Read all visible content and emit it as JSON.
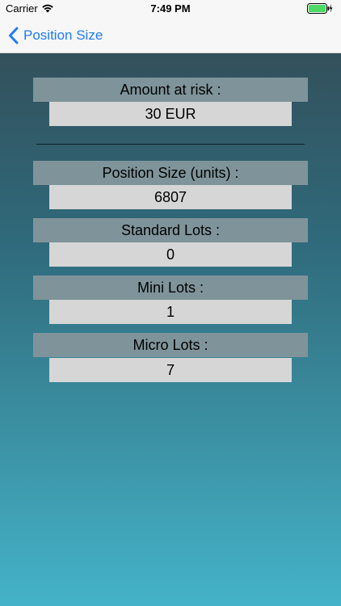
{
  "status_bar": {
    "carrier": "Carrier",
    "time": "7:49 PM"
  },
  "nav": {
    "back_label": "Position Size"
  },
  "results": {
    "amount_at_risk_label": "Amount at risk :",
    "amount_at_risk_value": "30 EUR",
    "position_size_label": "Position Size (units) :",
    "position_size_value": "6807",
    "standard_lots_label": "Standard Lots :",
    "standard_lots_value": "0",
    "mini_lots_label": "Mini Lots :",
    "mini_lots_value": "1",
    "micro_lots_label": "Micro Lots :",
    "micro_lots_value": "7"
  },
  "colors": {
    "accent": "#1e7cf6",
    "header_bg": "#7f949a",
    "value_bg": "#d6d6d6",
    "battery": "#4cd964"
  },
  "icons": {
    "wifi": "wifi-icon",
    "battery": "battery-charging-icon",
    "back": "chevron-left-icon"
  }
}
